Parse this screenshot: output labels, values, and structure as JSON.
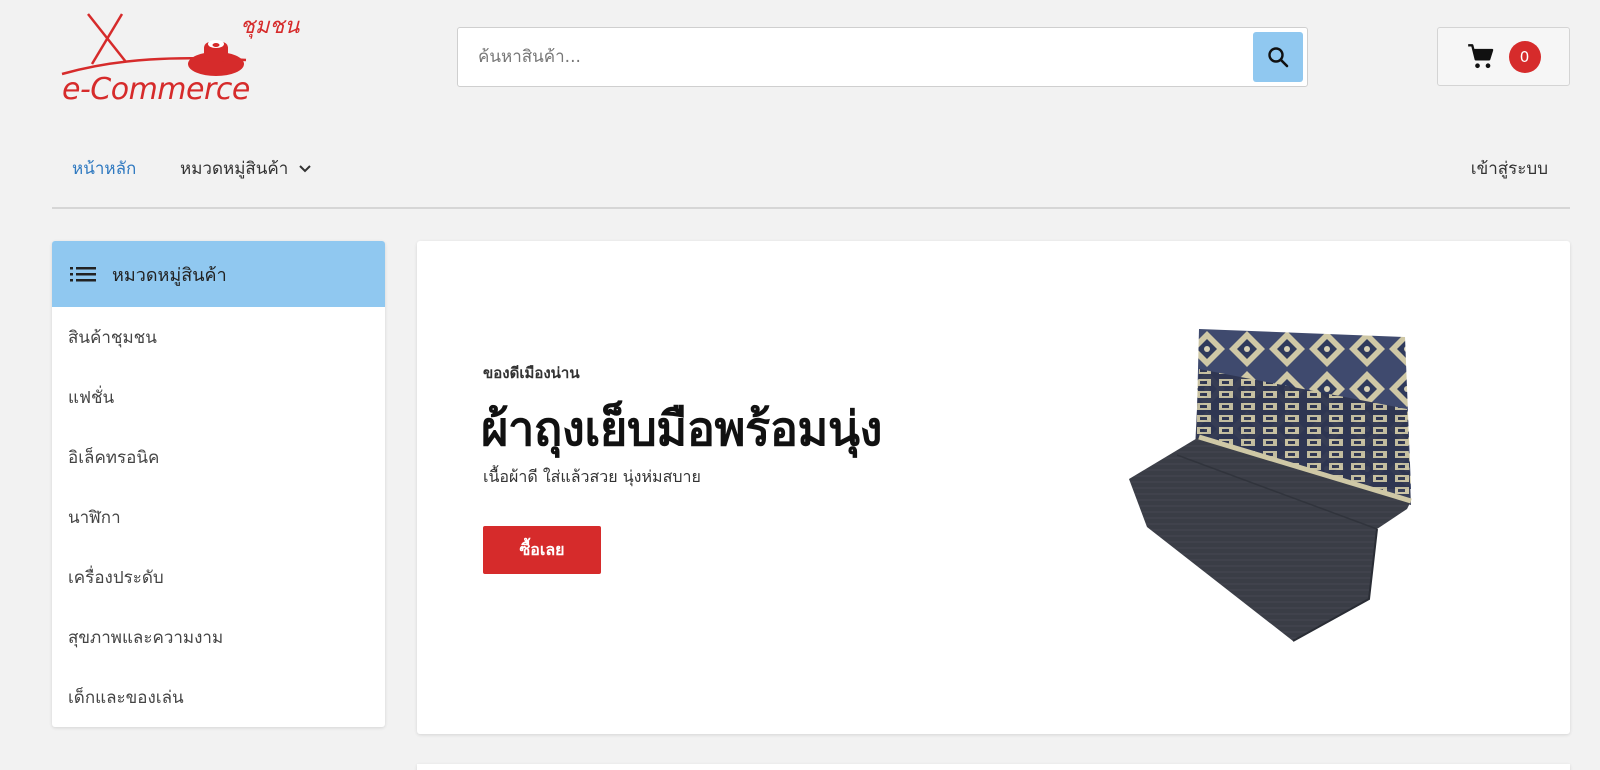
{
  "header": {
    "logo_text": "e-Commerce",
    "logo_community": "ชุมชน",
    "search_placeholder": "ค้นหาสินค้า...",
    "cart_count": "0"
  },
  "nav": {
    "home": "หน้าหลัก",
    "categories": "หมวดหมู่สินค้า",
    "login": "เข้าสู่ระบบ"
  },
  "sidebar": {
    "title": "หมวดหมู่สินค้า",
    "items": [
      {
        "label": "สินค้าชุมชน"
      },
      {
        "label": "แฟชั่น"
      },
      {
        "label": "อิเล็คทรอนิค"
      },
      {
        "label": "นาฬิกา"
      },
      {
        "label": "เครื่องประดับ"
      },
      {
        "label": "สุขภาพและความงาม"
      },
      {
        "label": "เด็กและของเล่น"
      }
    ]
  },
  "banner": {
    "kicker": "ของดีเมืองน่าน",
    "title": "ผ้าถุงเย็บมือพร้อมนุ่ง",
    "subtitle": "เนื้อผ้าดี ใส่แล้วสวย นุ่งห่มสบาย",
    "button": "ซื้อเลย"
  },
  "colors": {
    "accent_blue": "#90c8f0",
    "brand_red": "#d62b2b",
    "link_blue": "#2f79c0"
  }
}
